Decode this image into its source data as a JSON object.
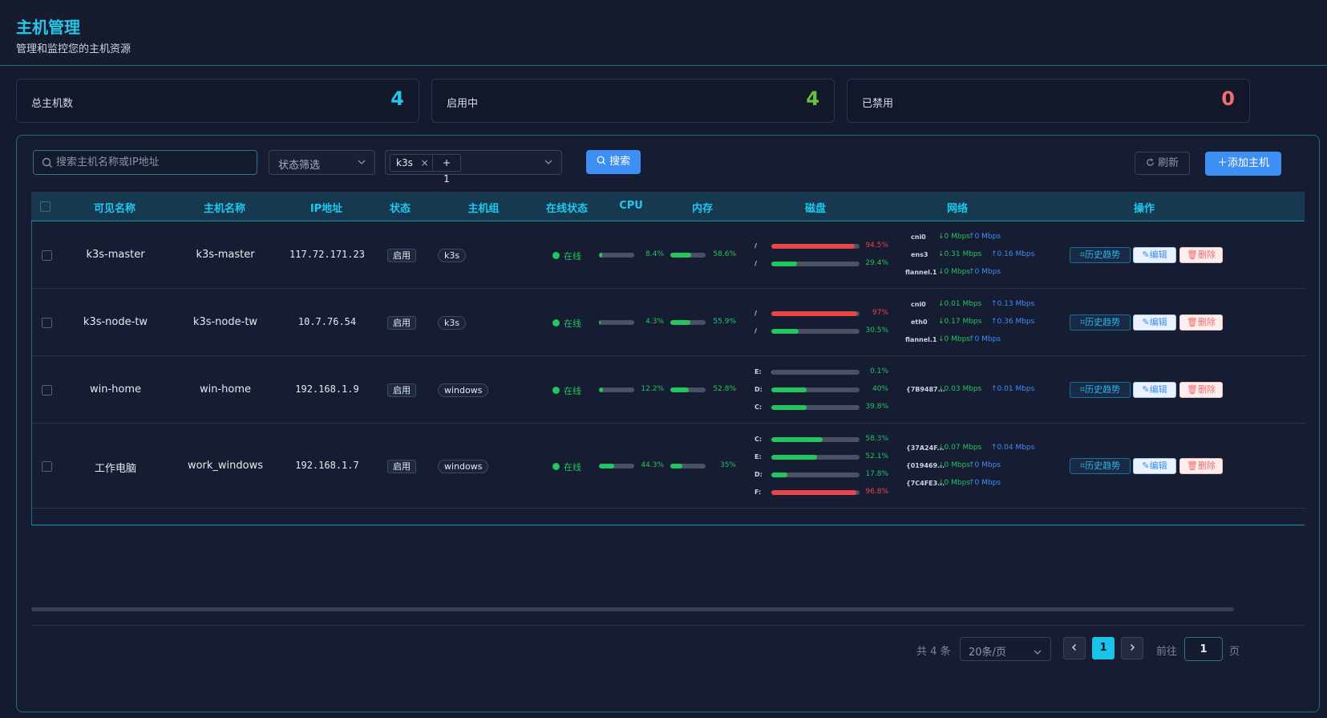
{
  "header": {
    "title": "主机管理",
    "subtitle": "管理和监控您的主机资源"
  },
  "stats": [
    {
      "label": "总主机数",
      "value": "4",
      "color": "#26c6e8"
    },
    {
      "label": "启用中",
      "value": "4",
      "color": "#67c23a"
    },
    {
      "label": "已禁用",
      "value": "0",
      "color": "#f56c6c"
    }
  ],
  "toolbar": {
    "search_placeholder": "搜索主机名称或IP地址",
    "status_filter": "状态筛选",
    "group_tag": "k3s",
    "group_more": "+ 1",
    "search_button": "搜索",
    "refresh_button": "刷新",
    "add_button": "添加主机"
  },
  "table": {
    "columns": [
      "可见名称",
      "主机名称",
      "IP地址",
      "状态",
      "主机组",
      "在线状态",
      "CPU",
      "内存",
      "磁盘",
      "网络",
      "操作"
    ],
    "actions": {
      "history": "历史趋势",
      "edit": "编辑",
      "delete": "删除"
    },
    "rows": [
      {
        "display_name": "k3s-master",
        "hostname": "k3s-master",
        "ip": "117.72.171.23",
        "status": "启用",
        "group": "k3s",
        "online": "在线",
        "cpu": "8.4%",
        "cpu_value": 8.4,
        "mem": "58.6%",
        "mem_value": 58.6,
        "disks": [
          {
            "name": "/",
            "pct": "94.5%",
            "value": 94.5
          },
          {
            "name": "/",
            "pct": "29.4%",
            "value": 29.4
          }
        ],
        "nets": [
          {
            "name": "cni0",
            "down": "↓0 Mbps",
            "up": "↑0 Mbps"
          },
          {
            "name": "ens3",
            "down": "↓0.31 Mbps",
            "up": "↑0.16 Mbps"
          },
          {
            "name": "flannel.1",
            "down": "↓0 Mbps",
            "up": "↑0 Mbps"
          }
        ]
      },
      {
        "display_name": "k3s-node-tw",
        "hostname": "k3s-node-tw",
        "ip": "10.7.76.54",
        "status": "启用",
        "group": "k3s",
        "online": "在线",
        "cpu": "4.3%",
        "cpu_value": 4.3,
        "mem": "55.9%",
        "mem_value": 55.9,
        "disks": [
          {
            "name": "/",
            "pct": "97%",
            "value": 97
          },
          {
            "name": "/",
            "pct": "30.5%",
            "value": 30.5
          }
        ],
        "nets": [
          {
            "name": "cni0",
            "down": "↓0.01 Mbps",
            "up": "↑0.13 Mbps"
          },
          {
            "name": "eth0",
            "down": "↓0.17 Mbps",
            "up": "↑0.36 Mbps"
          },
          {
            "name": "flannel.1",
            "down": "↓0 Mbps",
            "up": "↑0 Mbps"
          }
        ]
      },
      {
        "display_name": "win-home",
        "hostname": "win-home",
        "ip": "192.168.1.9",
        "status": "启用",
        "group": "windows",
        "online": "在线",
        "cpu": "12.2%",
        "cpu_value": 12.2,
        "mem": "52.8%",
        "mem_value": 52.8,
        "disks": [
          {
            "name": "E:",
            "pct": "0.1%",
            "value": 0.1
          },
          {
            "name": "D:",
            "pct": "40%",
            "value": 40
          },
          {
            "name": "C:",
            "pct": "39.8%",
            "value": 39.8
          }
        ],
        "nets": [
          {
            "name": "{7B9487...",
            "down": "↓0.03 Mbps",
            "up": "↑0.01 Mbps"
          }
        ]
      },
      {
        "display_name": "工作电脑",
        "hostname": "work_windows",
        "ip": "192.168.1.7",
        "status": "启用",
        "group": "windows",
        "online": "在线",
        "cpu": "44.3%",
        "cpu_value": 44.3,
        "mem": "35%",
        "mem_value": 35,
        "disks": [
          {
            "name": "C:",
            "pct": "58.3%",
            "value": 58.3
          },
          {
            "name": "E:",
            "pct": "52.1%",
            "value": 52.1
          },
          {
            "name": "D:",
            "pct": "17.8%",
            "value": 17.8
          },
          {
            "name": "F:",
            "pct": "96.8%",
            "value": 96.8
          }
        ],
        "nets": [
          {
            "name": "{37A24F...",
            "down": "↓0.07 Mbps",
            "up": "↑0.04 Mbps"
          },
          {
            "name": "{019469...",
            "down": "↓0 Mbps",
            "up": "↑0 Mbps"
          },
          {
            "name": "{7C4FE3...",
            "down": "↓0 Mbps",
            "up": "↑0 Mbps"
          }
        ]
      }
    ]
  },
  "pagination": {
    "total": "共 4 条",
    "page_size": "20条/页",
    "current": "1",
    "goto_label": "前往",
    "goto_value": "1",
    "unit": "页"
  }
}
